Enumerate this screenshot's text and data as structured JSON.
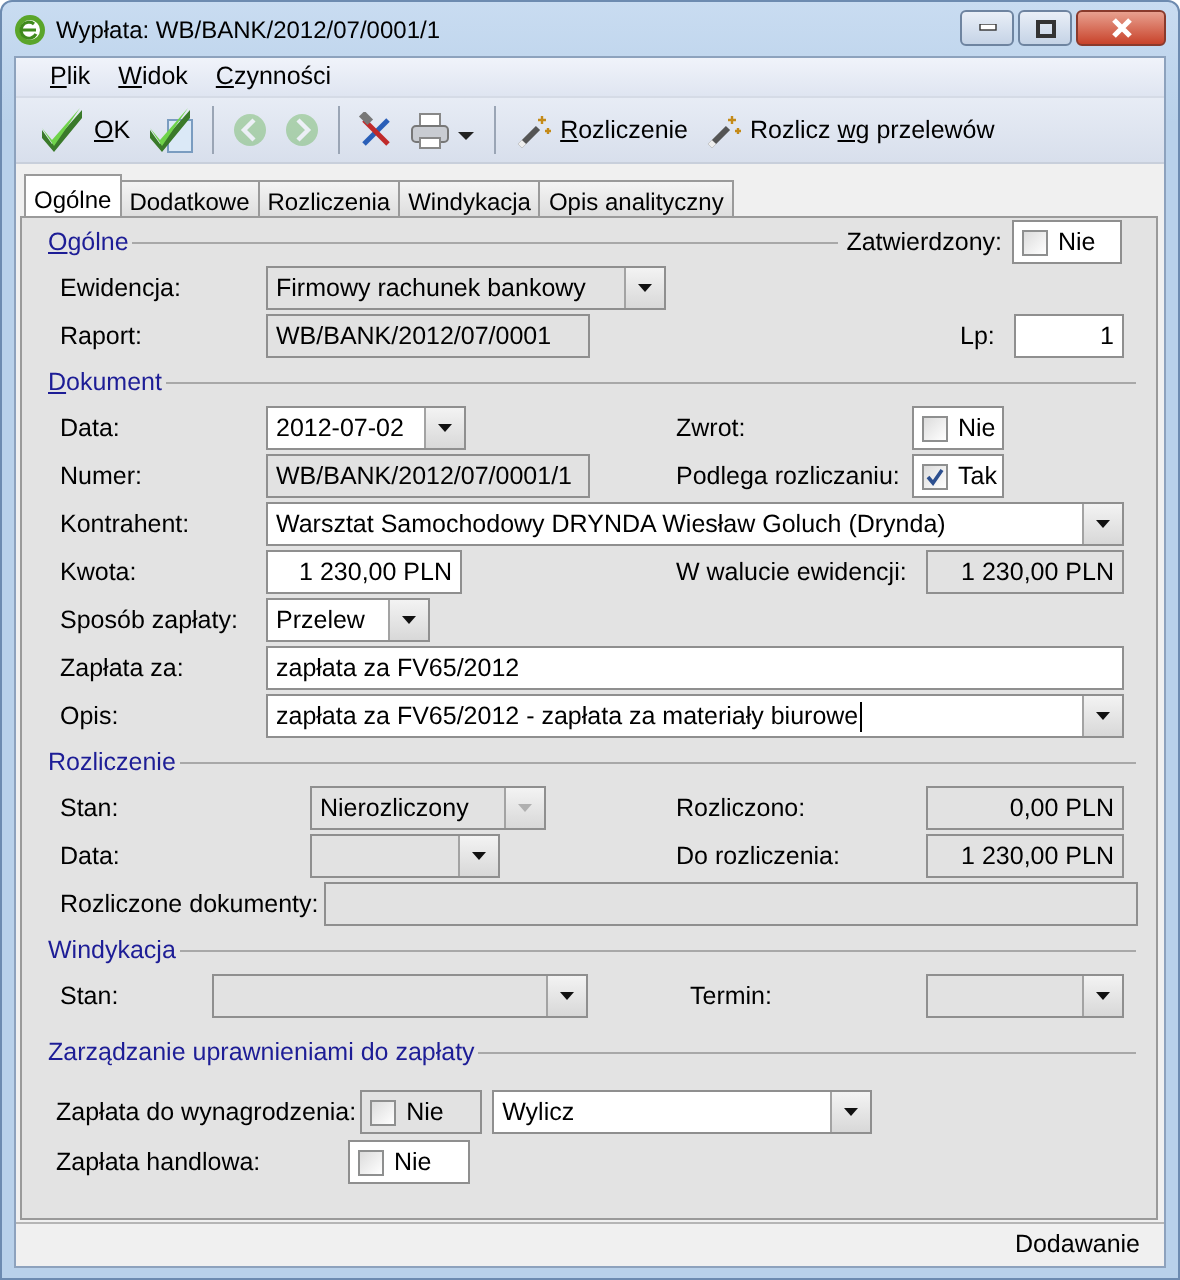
{
  "window": {
    "title": "Wypłata: WB/BANK/2012/07/0001/1"
  },
  "menu": [
    {
      "label_parts": [
        {
          "text": "P",
          "mnemonic": true
        },
        {
          "text": "lik",
          "mnemonic": false
        }
      ]
    },
    {
      "label_parts": [
        {
          "text": "W",
          "mnemonic": true
        },
        {
          "text": "idok",
          "mnemonic": false
        }
      ]
    },
    {
      "label_parts": [
        {
          "text": "C",
          "mnemonic": true
        },
        {
          "text": "zynności",
          "mnemonic": false
        }
      ]
    }
  ],
  "toolbar": [
    {
      "kind": "confirm",
      "label_parts": [
        {
          "text": "O",
          "mnemonic": true
        },
        {
          "text": "K",
          "mnemonic": false
        }
      ],
      "disabled": false
    },
    {
      "kind": "confirm-next",
      "disabled": false
    },
    {
      "kind": "separator"
    },
    {
      "kind": "back",
      "disabled": true
    },
    {
      "kind": "forward",
      "disabled": true
    },
    {
      "kind": "separator"
    },
    {
      "kind": "tools",
      "disabled": false
    },
    {
      "kind": "print",
      "disabled": false
    },
    {
      "kind": "separator"
    },
    {
      "kind": "wand",
      "label_parts": [
        {
          "text": "R",
          "mnemonic": true
        },
        {
          "text": "ozliczenie",
          "mnemonic": false
        }
      ],
      "disabled": false
    },
    {
      "kind": "wand",
      "label_parts": [
        {
          "text": "Rozlicz ",
          "mnemonic": false
        },
        {
          "text": "wg",
          "mnemonic": true
        },
        {
          "text": " przelewów",
          "mnemonic": false
        }
      ],
      "disabled": false
    }
  ],
  "tabs": [
    {
      "label": "Ogólne",
      "selected": true
    },
    {
      "label": "Dodatkowe",
      "selected": false
    },
    {
      "label": "Rozliczenia",
      "selected": false
    },
    {
      "label": "Windykacja",
      "selected": false
    },
    {
      "label": "Opis analityczny",
      "selected": false
    }
  ],
  "sections": [
    {
      "title_parts": [
        {
          "text": "O",
          "mnemonic": true
        },
        {
          "text": "gólne",
          "mnemonic": false
        }
      ],
      "aside": [
        {
          "kind": "label",
          "text": "Zatwierdzony:"
        },
        {
          "kind": "check",
          "checked": false,
          "text": "Nie",
          "editable": true
        }
      ],
      "rows": [
        {
          "cells": [
            {
              "kind": "label",
              "text": "Ewidencja:"
            },
            {
              "kind": "combo",
              "value": "Firmowy rachunek bankowy",
              "editable": false,
              "disabled": false
            }
          ]
        },
        {
          "cells": [
            {
              "kind": "label",
              "text": "Raport:"
            },
            {
              "kind": "text",
              "value": "WB/BANK/2012/07/0001",
              "editable": false
            },
            {
              "kind": "label",
              "text": "Lp:"
            },
            {
              "kind": "amount",
              "value": "1",
              "editable": true
            }
          ]
        }
      ]
    },
    {
      "title_parts": [
        {
          "text": "D",
          "mnemonic": true
        },
        {
          "text": "okument",
          "mnemonic": false
        }
      ],
      "rows": [
        {
          "cells": [
            {
              "kind": "label",
              "text": "Data:"
            },
            {
              "kind": "combo",
              "value": "2012-07-02",
              "editable": true,
              "disabled": false
            },
            {
              "kind": "label",
              "text": "Zwrot:"
            },
            {
              "kind": "check",
              "checked": false,
              "text": "Nie",
              "editable": true
            }
          ]
        },
        {
          "cells": [
            {
              "kind": "label",
              "text": "Numer:"
            },
            {
              "kind": "text",
              "value": "WB/BANK/2012/07/0001/1",
              "editable": false
            },
            {
              "kind": "label",
              "text": "Podlega rozliczaniu:"
            },
            {
              "kind": "check",
              "checked": true,
              "text": "Tak",
              "editable": true
            }
          ]
        },
        {
          "cells": [
            {
              "kind": "label",
              "text": "Kontrahent:"
            },
            {
              "kind": "combo",
              "value": "Warsztat Samochodowy DRYNDA Wiesław Goluch (Drynda)",
              "editable": true,
              "disabled": false
            }
          ]
        },
        {
          "cells": [
            {
              "kind": "label",
              "text": "Kwota:"
            },
            {
              "kind": "amount",
              "value": "1 230,00 PLN",
              "editable": true
            },
            {
              "kind": "label",
              "text": "W walucie ewidencji:"
            },
            {
              "kind": "amount",
              "value": "1 230,00 PLN",
              "editable": false
            }
          ]
        },
        {
          "cells": [
            {
              "kind": "label",
              "text": "Sposób zapłaty:"
            },
            {
              "kind": "combo",
              "value": "Przelew",
              "editable": true,
              "disabled": false
            }
          ]
        },
        {
          "cells": [
            {
              "kind": "label",
              "text": "Zapłata za:"
            },
            {
              "kind": "text",
              "value": "zapłata za FV65/2012",
              "editable": true
            }
          ]
        },
        {
          "cells": [
            {
              "kind": "label",
              "text": "Opis:"
            },
            {
              "kind": "combo",
              "value": "zapłata za FV65/2012 - zapłata za materiały biurowe",
              "editable": true,
              "disabled": false,
              "focused": true
            }
          ]
        }
      ]
    },
    {
      "title_parts": [
        {
          "text": "Rozliczenie",
          "mnemonic": false
        }
      ],
      "rows": [
        {
          "cells": [
            {
              "kind": "label",
              "text": "Stan:"
            },
            {
              "kind": "combo",
              "value": "Nierozliczony",
              "editable": false,
              "disabled": true
            },
            {
              "kind": "label",
              "text": "Rozliczono:"
            },
            {
              "kind": "amount",
              "value": "0,00 PLN",
              "editable": false
            }
          ]
        },
        {
          "cells": [
            {
              "kind": "label",
              "text": "Data:"
            },
            {
              "kind": "combo",
              "editable": false,
              "disabled": false
            },
            {
              "kind": "label",
              "text": "Do rozliczenia:"
            },
            {
              "kind": "amount",
              "value": "1 230,00 PLN",
              "editable": false
            }
          ]
        },
        {
          "cells": [
            {
              "kind": "label",
              "text": "Rozliczone dokumenty:"
            },
            {
              "kind": "text",
              "editable": false
            }
          ]
        }
      ]
    },
    {
      "title_parts": [
        {
          "text": "Windykacja",
          "mnemonic": false
        }
      ],
      "rows": [
        {
          "cells": [
            {
              "kind": "label",
              "text": "Stan:"
            },
            {
              "kind": "combo",
              "editable": false,
              "disabled": false
            },
            {
              "kind": "label",
              "text": "Termin:"
            },
            {
              "kind": "combo",
              "editable": false,
              "disabled": false
            }
          ]
        }
      ]
    },
    {
      "title_parts": [
        {
          "text": "Zarządzanie uprawnieniami do zapłaty",
          "mnemonic": false
        }
      ],
      "rows": [
        {
          "cells": [
            {
              "kind": "label",
              "text": "Zapłata do wynagrodzenia:"
            },
            {
              "kind": "check",
              "checked": false,
              "text": "Nie",
              "editable": false
            },
            {
              "kind": "combo",
              "value": "Wylicz",
              "editable": true,
              "disabled": false
            }
          ]
        },
        {
          "cells": [
            {
              "kind": "label",
              "text": "Zapłata handlowa:"
            },
            {
              "kind": "check",
              "checked": false,
              "text": "Nie",
              "editable": true
            }
          ]
        }
      ]
    }
  ],
  "status_bar": {
    "text": "Dodawanie"
  }
}
